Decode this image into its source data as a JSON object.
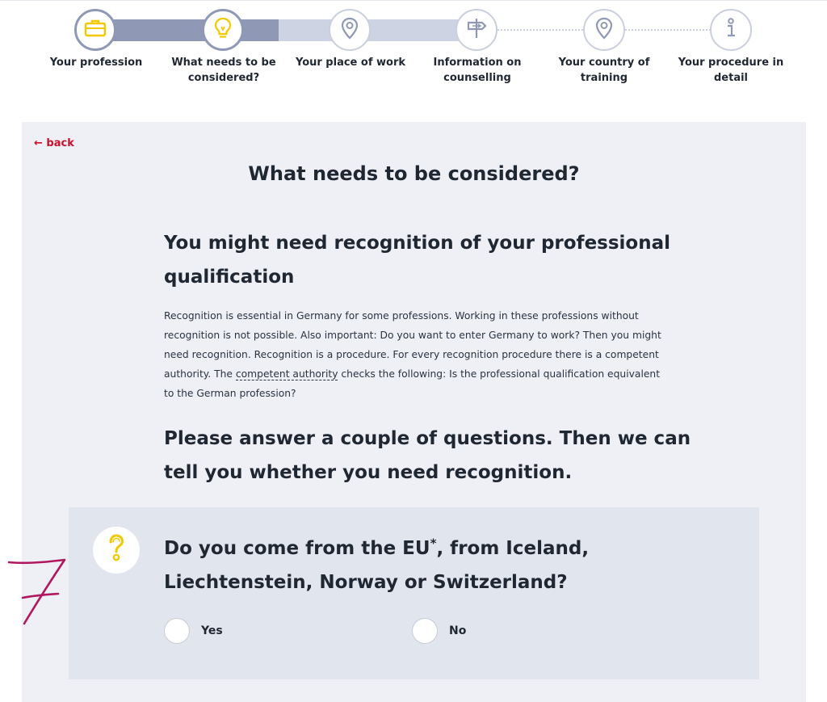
{
  "stepper": {
    "steps": [
      {
        "label": "Your profession",
        "icon": "briefcase-icon",
        "state": "done"
      },
      {
        "label": "What needs to be considered?",
        "icon": "lightbulb-icon",
        "state": "current"
      },
      {
        "label": "Your place of work",
        "icon": "map-pin-icon",
        "state": "upcoming"
      },
      {
        "label": "Information on counselling",
        "icon": "signpost-icon",
        "state": "upcoming"
      },
      {
        "label": "Your country of training",
        "icon": "map-pin-icon",
        "state": "upcoming"
      },
      {
        "label": "Your procedure in detail",
        "icon": "info-icon",
        "state": "upcoming"
      }
    ]
  },
  "back_link": "← back",
  "page_title": "What needs to be considered?",
  "section_heading": "You might need recognition of your professional qualification",
  "body": {
    "text_before": "Recognition is essential in Germany for some professions. Working in these professions without recognition is not possible. Also important: Do you want to enter Germany to work? Then you might need recognition. Recognition is a procedure. For every recognition procedure there is a competent authority. The ",
    "glossary_term": "competent authority",
    "text_after": " checks the following: Is the professional qualification equivalent to the German profession?"
  },
  "intro_question": "Please answer a couple of questions. Then we can tell you whether you need recognition.",
  "question": {
    "text_before": "Do you come from the EU",
    "footnote_mark": "*",
    "text_after": ", from Iceland, Liechtenstein, Norway or Switzerland?",
    "options": [
      "Yes",
      "No"
    ],
    "help_icon": "question-mark-icon"
  },
  "annotation": "7",
  "colors": {
    "panel_bg": "#eef0f5",
    "card_bg": "#e1e5ee",
    "progress_done": "#8f99b6",
    "accent_yellow": "#f4c800",
    "back_link_red": "#c8102e",
    "annotation_magenta": "#b0175e"
  }
}
